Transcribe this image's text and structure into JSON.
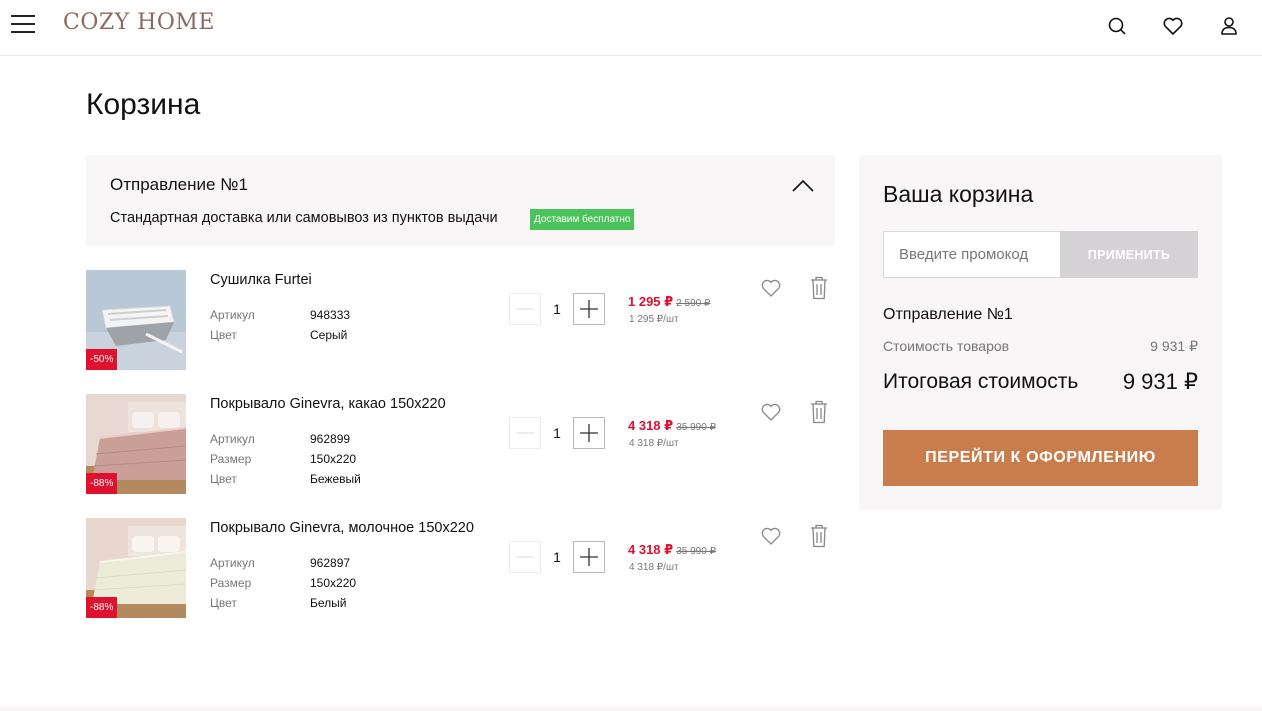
{
  "header": {
    "logo": "COZY HOME",
    "icons": [
      "menu-icon",
      "search-icon",
      "heart-icon",
      "user-icon"
    ]
  },
  "page": {
    "title": "Корзина"
  },
  "shipment": {
    "title": "Отправление №1",
    "description": "Стандартная доставка или самовывоз из пунктов выдачи",
    "badge": "Доставим бесплатно"
  },
  "cart_items": [
    {
      "name": "Сушилка Furtei",
      "discount": "-50%",
      "attributes": [
        {
          "label": "Артикул",
          "value": "948333"
        },
        {
          "label": "Цвет",
          "value": "Серый"
        }
      ],
      "quantity": "1",
      "price": "1 295 ₽",
      "old_price": "2 590 ₽",
      "unit_price": "1 295 ₽/шт"
    },
    {
      "name": "Покрывало Ginevra, какао 150х220",
      "discount": "-88%",
      "attributes": [
        {
          "label": "Артикул",
          "value": "962899"
        },
        {
          "label": "Размер",
          "value": "150х220"
        },
        {
          "label": "Цвет",
          "value": "Бежевый"
        }
      ],
      "quantity": "1",
      "price": "4 318 ₽",
      "old_price": "35 990 ₽",
      "unit_price": "4 318 ₽/шт"
    },
    {
      "name": "Покрывало Ginevra, молочное 150х220",
      "discount": "-88%",
      "attributes": [
        {
          "label": "Артикул",
          "value": "962897"
        },
        {
          "label": "Размер",
          "value": "150х220"
        },
        {
          "label": "Цвет",
          "value": "Белый"
        }
      ],
      "quantity": "1",
      "price": "4 318 ₽",
      "old_price": "35 990 ₽",
      "unit_price": "4 318 ₽/шт"
    }
  ],
  "summary": {
    "title": "Ваша корзина",
    "promo_placeholder": "Введите промокод",
    "apply_label": "ПРИМЕНИТЬ",
    "shipment_label": "Отправление №1",
    "goods_label": "Стоимость товаров",
    "goods_value": "9 931 ₽",
    "total_label": "Итоговая стоимость",
    "total_value": "9 931 ₽",
    "checkout_label": "ПЕРЕЙТИ К ОФОРМЛЕНИЮ"
  },
  "colors": {
    "accent": "#c97d4c",
    "discount": "#e0102f",
    "badge_green": "#4ac35a",
    "panel_bg": "#f8f6f7"
  }
}
